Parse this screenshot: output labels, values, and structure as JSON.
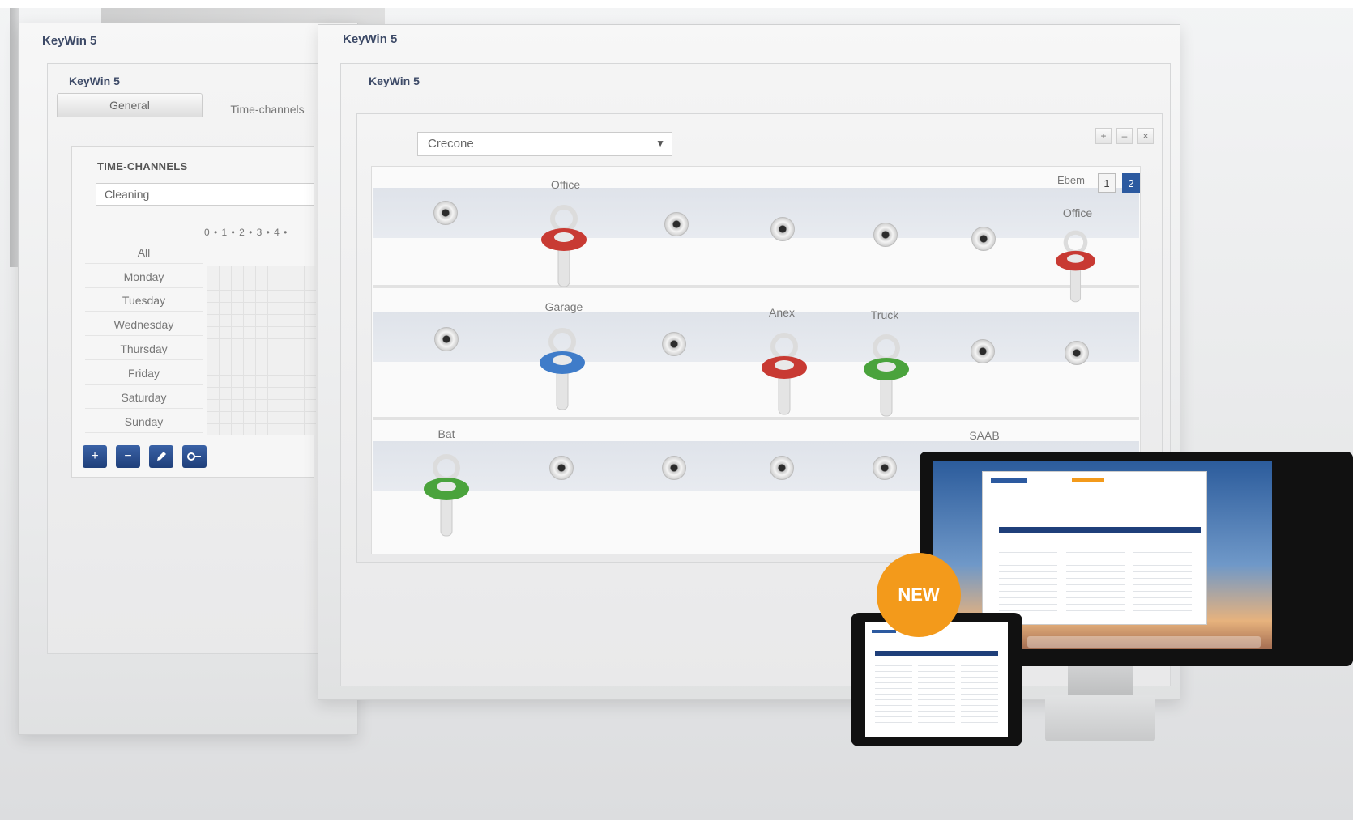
{
  "back_window": {
    "title": "KeyWin 5",
    "inner_title": "KeyWin 5",
    "tabs": [
      "General",
      "Time-channels"
    ],
    "section_heading": "TIME-CHANNELS",
    "channel_value": "Cleaning",
    "hour_scale": "0 • 1 • 2 • 3 • 4 •",
    "days": [
      "All",
      "Monday",
      "Tuesday",
      "Wednesday",
      "Thursday",
      "Friday",
      "Saturday",
      "Sunday"
    ],
    "toolbar_icons": [
      "plus-icon",
      "minus-icon",
      "pencil-icon",
      "key-icon"
    ]
  },
  "main_window": {
    "title": "KeyWin 5",
    "inner_title": "KeyWin 5",
    "window_controls": [
      "+",
      "–",
      "×"
    ],
    "cabinet_select": "Crecone",
    "keys_label": "Ebem",
    "pages": [
      "1",
      "2"
    ],
    "key_labels": {
      "office_1": "Office",
      "office_2": "Office",
      "garage": "Garage",
      "anex": "Anex",
      "truck": "Truck",
      "boat": "Bat",
      "saab": "SAAB"
    },
    "key_colors": {
      "red": "#c83a33",
      "blue": "#3f7cc9",
      "green": "#4aa33c"
    }
  },
  "promo": {
    "badge": "NEW"
  }
}
